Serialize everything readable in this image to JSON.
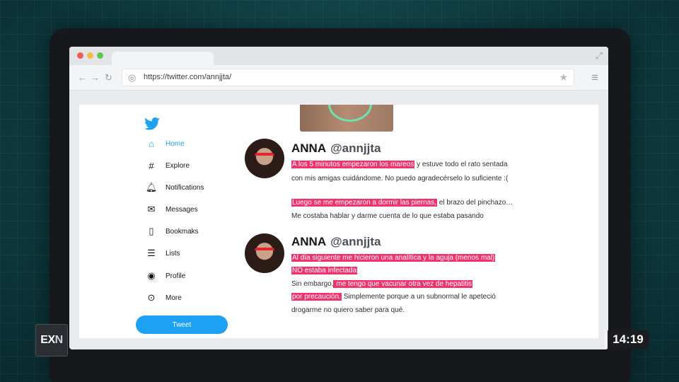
{
  "browser": {
    "url": "https://twitter.com/annjjta/",
    "icons": [
      "back-arrow-icon",
      "forward-arrow-icon",
      "reload-icon",
      "globe-icon",
      "star-icon",
      "menu-icon",
      "expand-icon"
    ]
  },
  "sidebar": {
    "items": [
      {
        "label": "Home",
        "icon": "home-icon",
        "active": true
      },
      {
        "label": "Explore",
        "icon": "hashtag-icon"
      },
      {
        "label": "Notifications",
        "icon": "bell-icon"
      },
      {
        "label": "Messages",
        "icon": "envelope-icon"
      },
      {
        "label": "Bookmaks",
        "icon": "bookmark-icon"
      },
      {
        "label": "Lists",
        "icon": "list-icon"
      },
      {
        "label": "Profile",
        "icon": "profile-icon"
      },
      {
        "label": "More",
        "icon": "more-icon"
      }
    ],
    "tweet_button": "Tweet"
  },
  "tweets": [
    {
      "name": "ANNA",
      "handle": "@annjjta",
      "lines": [
        {
          "hl": "A los 5 minutos empezaron los mareos",
          "text": " y estuve todo el rato sentada"
        },
        {
          "text": "con mis amigas cuidándome. No puedo agradecérselo lo suficiente :("
        },
        {
          "hl": "Luego se me empezaron a dormir las piernas,",
          "text": " el brazo del pinchazo…"
        },
        {
          "text": "Me costaba hablar y darme cuenta de lo que estaba pasando"
        }
      ]
    },
    {
      "name": "ANNA",
      "handle": "@annjjta",
      "lines": [
        {
          "hl": "Al día siguiente me hicieron una analítica y la aguja (menos mal)"
        },
        {
          "hl": "NO estaba infectada"
        },
        {
          "pre": "Sin embargo,",
          "hl": " me tengo que vacunar otra vez de hepatitis"
        },
        {
          "hl": "por precaución.",
          "text": " Simplemente porque a un subnormal le apeteció"
        },
        {
          "text": "drogarme no quiero saber para qué."
        }
      ]
    }
  ],
  "overlay": {
    "logo_main": "EX",
    "logo_accent": "N",
    "clock": "14:19"
  },
  "colors": {
    "twitter_blue": "#1da1f2",
    "highlight": "#f0336d"
  }
}
